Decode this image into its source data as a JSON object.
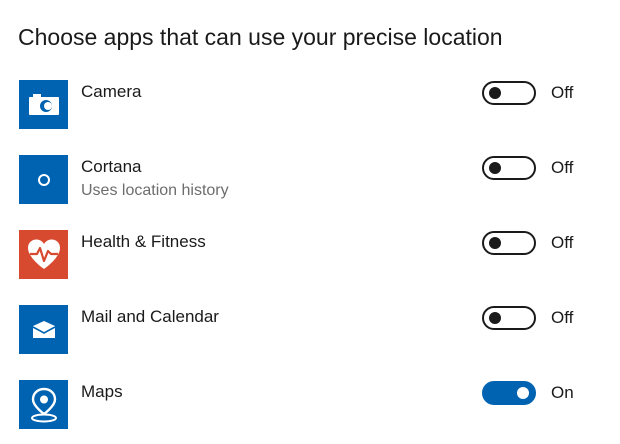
{
  "heading": "Choose apps that can use your precise location",
  "apps": [
    {
      "name": "Camera",
      "subtitle": "",
      "icon": "camera-icon",
      "tile_color": "#0063b1",
      "enabled": false,
      "state_label": "Off"
    },
    {
      "name": "Cortana",
      "subtitle": "Uses location history",
      "icon": "cortana-icon",
      "tile_color": "#0063b1",
      "enabled": false,
      "state_label": "Off"
    },
    {
      "name": "Health & Fitness",
      "subtitle": "",
      "icon": "heart-icon",
      "tile_color": "#d84a30",
      "enabled": false,
      "state_label": "Off"
    },
    {
      "name": "Mail and Calendar",
      "subtitle": "",
      "icon": "envelope-icon",
      "tile_color": "#0063b1",
      "enabled": false,
      "state_label": "Off"
    },
    {
      "name": "Maps",
      "subtitle": "",
      "icon": "map-pin-icon",
      "tile_color": "#0063b1",
      "enabled": true,
      "state_label": "On"
    }
  ],
  "colors": {
    "accent": "#0063b1",
    "health_tile": "#d84a30",
    "subtitle_text": "#6d6d6d"
  }
}
